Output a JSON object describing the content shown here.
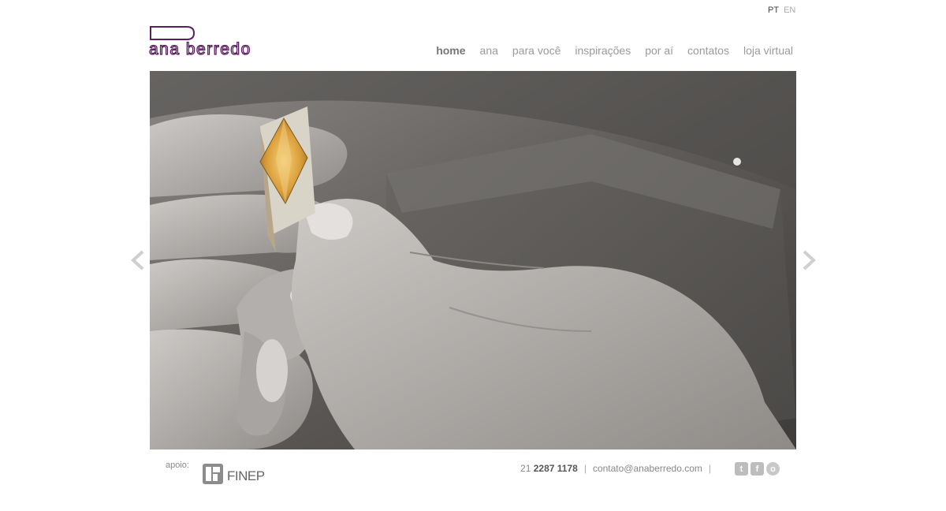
{
  "language": {
    "options": [
      "PT",
      "EN"
    ],
    "selected": "PT"
  },
  "brand": {
    "name": "ana berredo",
    "color": "#5b1f61"
  },
  "nav": {
    "items": [
      "home",
      "ana",
      "para você",
      "inspirações",
      "por aí",
      "contatos",
      "loja virtual"
    ],
    "current": "home"
  },
  "hero": {
    "image_subject": "hands holding gold ring with marquise citrine stone over workbench"
  },
  "footer": {
    "support_label": "apoio:",
    "sponsor_name": "FINEP",
    "phone_prefix": "21",
    "phone_number": "2287 1178",
    "separator": "|",
    "email": "contato@anaberredo.com"
  },
  "social": [
    "twitter-icon",
    "facebook-icon",
    "orkut-icon"
  ],
  "social_glyphs": [
    "t",
    "f",
    "o"
  ],
  "colors": {
    "nav_text": "#9a9a9a",
    "nav_current": "#777777",
    "accent": "#5b1f61"
  }
}
